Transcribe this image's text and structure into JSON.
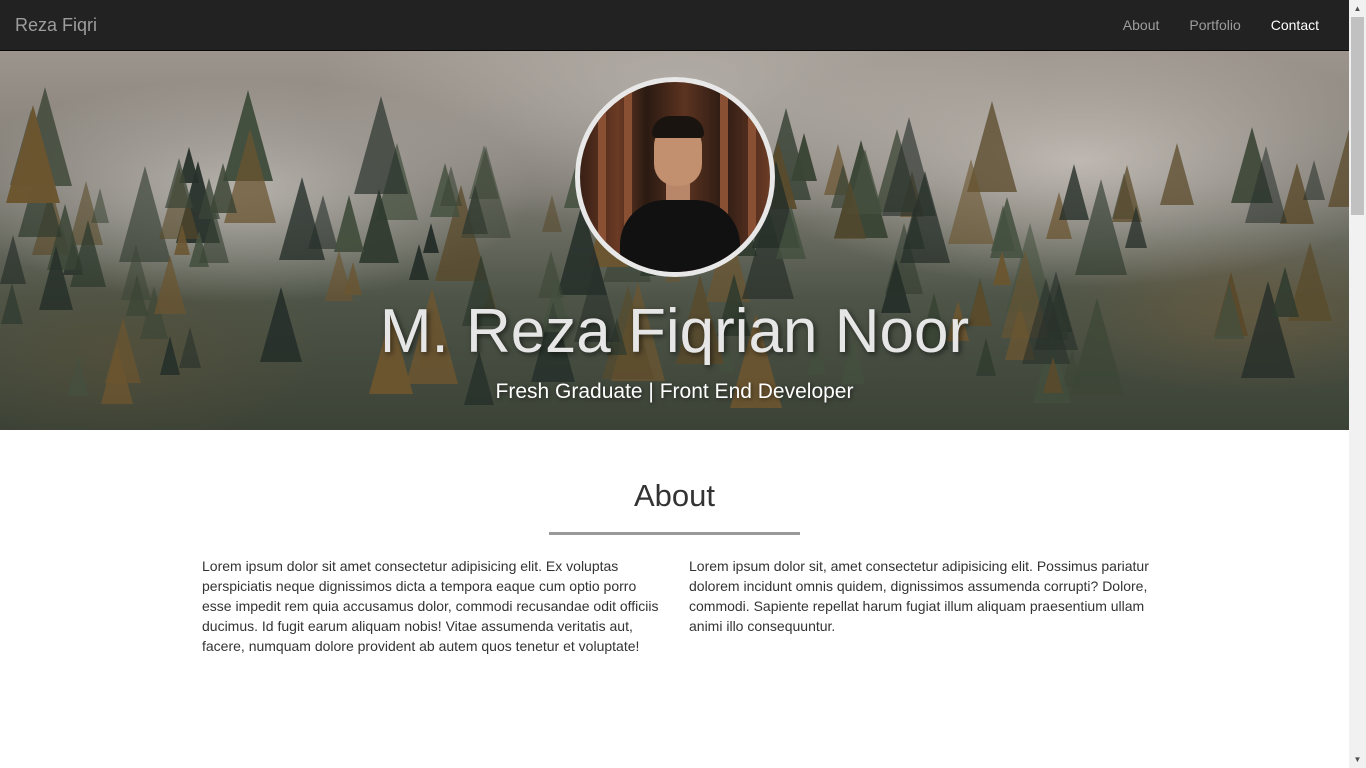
{
  "navbar": {
    "brand": "Reza Fiqri",
    "links": [
      {
        "label": "About"
      },
      {
        "label": "Portfolio"
      },
      {
        "label": "Contact"
      }
    ]
  },
  "hero": {
    "name": "M. Reza Fiqrian Noor",
    "tagline": "Fresh Graduate | Front End Developer"
  },
  "about": {
    "title": "About",
    "left": "Lorem ipsum dolor sit amet consectetur adipisicing elit. Ex voluptas perspiciatis neque dignissimos dicta a tempora eaque cum optio porro esse impedit rem quia accusamus dolor, commodi recusandae odit officiis ducimus. Id fugit earum aliquam nobis! Vitae assumenda veritatis aut, facere, numquam dolore provident ab autem quos tenetur et voluptate!",
    "right": "Lorem ipsum dolor sit, amet consectetur adipisicing elit. Possimus pariatur dolorem incidunt omnis quidem, dignissimos assumenda corrupti? Dolore, commodi. Sapiente repellat harum fugiat illum aliquam praesentium ullam animi illo consequuntur."
  },
  "colors": {
    "navbar": "#222222",
    "nav_link": "#9d9d9d",
    "nav_link_active": "#ffffff"
  }
}
